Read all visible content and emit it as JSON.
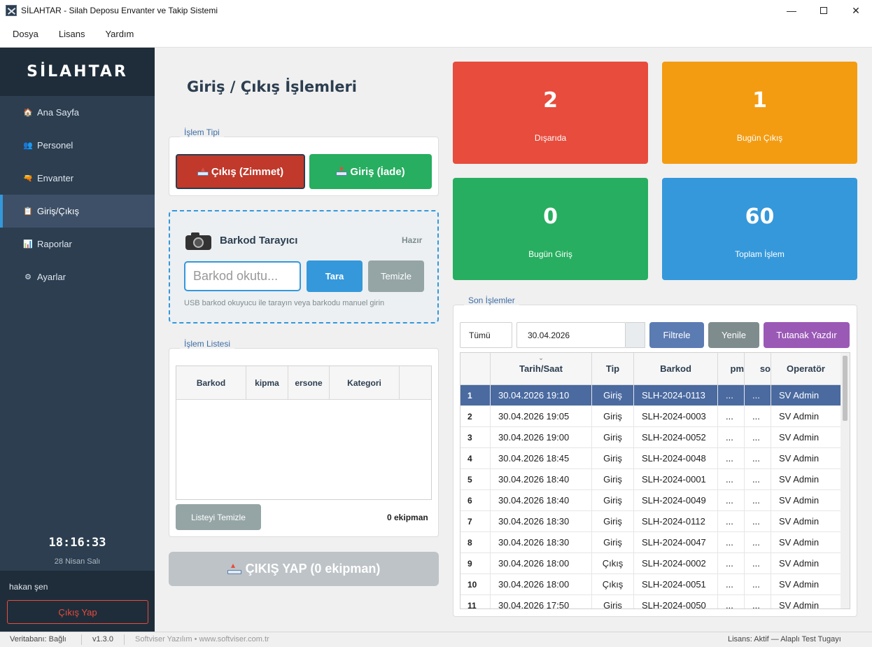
{
  "window": {
    "title": "SİLAHTAR - Silah Deposu Envanter ve Takip Sistemi",
    "minimize": "—",
    "close": "✕"
  },
  "menu": [
    "Dosya",
    "Lisans",
    "Yardım"
  ],
  "sidebar": {
    "brand": "SİLAHTAR",
    "items": [
      {
        "label": "Ana Sayfa",
        "icon": "house-icon",
        "glyph": "🏠"
      },
      {
        "label": "Personel",
        "icon": "people-icon",
        "glyph": "👥"
      },
      {
        "label": "Envanter",
        "icon": "gun-icon",
        "glyph": "🔫"
      },
      {
        "label": "Giriş/Çıkış",
        "icon": "clipboard-icon",
        "glyph": "📋",
        "active": true
      },
      {
        "label": "Raporlar",
        "icon": "chart-icon",
        "glyph": "📊"
      },
      {
        "label": "Ayarlar",
        "icon": "gear-icon",
        "glyph": "⚙"
      }
    ],
    "clock": "18:16:33",
    "date": "28 Nisan Salı",
    "user": "hakan şen",
    "logout": "Çıkış Yap"
  },
  "main": {
    "title": "Giriş / Çıkış İşlemleri",
    "type_group": {
      "label": "İşlem Tipi",
      "cikis": "Çıkış (Zimmet)",
      "giris": "Giriş (İade)"
    },
    "scanner": {
      "title": "Barkod Tarayıcı",
      "status": "Hazır",
      "placeholder": "Barkod okutu...",
      "scan": "Tara",
      "clear": "Temizle",
      "help": "USB barkod okuyucu ile tarayın veya barkodu manuel girin"
    },
    "list": {
      "label": "İşlem Listesi",
      "columns": [
        "Barkod",
        "kipma",
        "ersone",
        "Kategori"
      ],
      "clear": "Listeyi Temizle",
      "count": "0 ekipman"
    },
    "submit": "ÇIKIŞ YAP (0 ekipman)"
  },
  "stats": [
    {
      "value": "2",
      "label": "Dışarıda",
      "color": "#e74c3c"
    },
    {
      "value": "1",
      "label": "Bugün Çıkış",
      "color": "#f39c12"
    },
    {
      "value": "0",
      "label": "Bugün Giriş",
      "color": "#27ae60"
    },
    {
      "value": "60",
      "label": "Toplam İşlem",
      "color": "#3498db"
    }
  ],
  "recent": {
    "label": "Son İşlemler",
    "filter_type": "Tümü",
    "filter_date": "30.04.2026",
    "filter_btn": "Filtrele",
    "refresh_btn": "Yenile",
    "report_btn": "Tutanak Yazdır",
    "columns": [
      "Tarih/Saat",
      "Tip",
      "Barkod",
      "pm",
      "so",
      "Operatör"
    ],
    "rows": [
      {
        "n": "1",
        "time": "30.04.2026 19:10",
        "type": "Giriş",
        "kind": "giris",
        "barcode": "SLH-2024-0113",
        "a": "...",
        "b": "...",
        "op": "SV Admin"
      },
      {
        "n": "2",
        "time": "30.04.2026 19:05",
        "type": "Giriş",
        "kind": "giris",
        "barcode": "SLH-2024-0003",
        "a": "...",
        "b": "...",
        "op": "SV Admin"
      },
      {
        "n": "3",
        "time": "30.04.2026 19:00",
        "type": "Giriş",
        "kind": "giris",
        "barcode": "SLH-2024-0052",
        "a": "...",
        "b": "...",
        "op": "SV Admin"
      },
      {
        "n": "4",
        "time": "30.04.2026 18:45",
        "type": "Giriş",
        "kind": "giris",
        "barcode": "SLH-2024-0048",
        "a": "...",
        "b": "...",
        "op": "SV Admin"
      },
      {
        "n": "5",
        "time": "30.04.2026 18:40",
        "type": "Giriş",
        "kind": "giris",
        "barcode": "SLH-2024-0001",
        "a": "...",
        "b": "...",
        "op": "SV Admin"
      },
      {
        "n": "6",
        "time": "30.04.2026 18:40",
        "type": "Giriş",
        "kind": "giris",
        "barcode": "SLH-2024-0049",
        "a": "...",
        "b": "...",
        "op": "SV Admin"
      },
      {
        "n": "7",
        "time": "30.04.2026 18:30",
        "type": "Giriş",
        "kind": "giris",
        "barcode": "SLH-2024-0112",
        "a": "...",
        "b": "...",
        "op": "SV Admin"
      },
      {
        "n": "8",
        "time": "30.04.2026 18:30",
        "type": "Giriş",
        "kind": "giris",
        "barcode": "SLH-2024-0047",
        "a": "...",
        "b": "...",
        "op": "SV Admin"
      },
      {
        "n": "9",
        "time": "30.04.2026 18:00",
        "type": "Çıkış",
        "kind": "cikis",
        "barcode": "SLH-2024-0002",
        "a": "...",
        "b": "...",
        "op": "SV Admin"
      },
      {
        "n": "10",
        "time": "30.04.2026 18:00",
        "type": "Çıkış",
        "kind": "cikis",
        "barcode": "SLH-2024-0051",
        "a": "...",
        "b": "...",
        "op": "SV Admin"
      },
      {
        "n": "11",
        "time": "30.04.2026 17:50",
        "type": "Giriş",
        "kind": "giris",
        "barcode": "SLH-2024-0050",
        "a": "...",
        "b": "...",
        "op": "SV Admin"
      }
    ]
  },
  "status": {
    "db": "Veritabanı: Bağlı",
    "version": "v1.3.0",
    "vendor": "Softviser Yazılım  •  www.softviser.com.tr",
    "license": "Lisans: Aktif — Alaplı Test Tugayı"
  }
}
